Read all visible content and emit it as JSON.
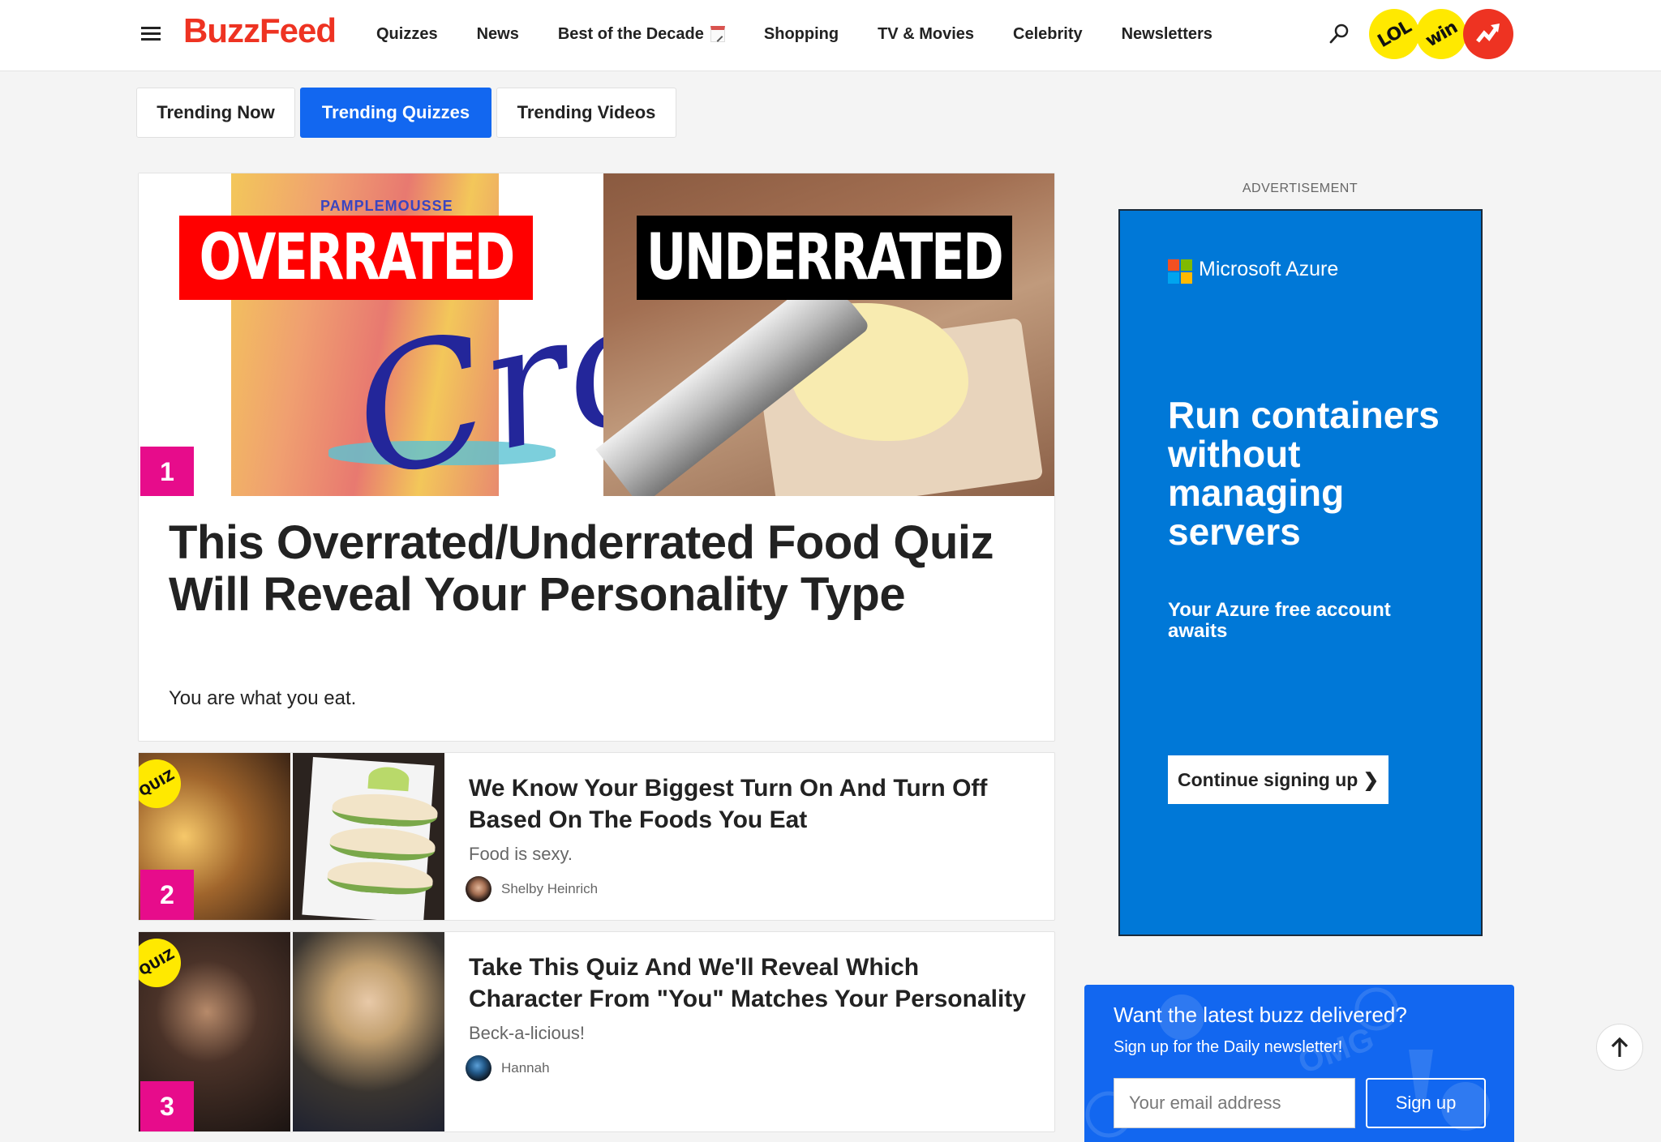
{
  "header": {
    "logo": "BuzzFeed",
    "brand_color": "#ee3322",
    "nav": [
      {
        "label": "Quizzes"
      },
      {
        "label": "News"
      },
      {
        "label": "Best of the Decade",
        "icon": "calendar-icon"
      },
      {
        "label": "Shopping"
      },
      {
        "label": "TV & Movies"
      },
      {
        "label": "Celebrity"
      },
      {
        "label": "Newsletters"
      }
    ],
    "badges": [
      {
        "label": "LOL",
        "color": "#ffe900"
      },
      {
        "label": "win",
        "color": "#ffe900"
      },
      {
        "label": "trending",
        "icon": "trending-arrow-icon",
        "color": "#ee3322"
      }
    ]
  },
  "tabs": [
    {
      "label": "Trending Now",
      "active": false
    },
    {
      "label": "Trending Quizzes",
      "active": true
    },
    {
      "label": "Trending Videos",
      "active": false
    }
  ],
  "accent_color": "#1267f0",
  "rank_color": "#e70c8b",
  "featured": {
    "rank": "1",
    "image_labels": {
      "left": "OVERRATED",
      "right": "UNDERRATED",
      "can_text": "PAMPLEMOUSSE",
      "can_script": "Croix"
    },
    "title": "This Overrated/Underrated Food Quiz Will Reveal Your Personality Type",
    "description": "You are what you eat."
  },
  "list": [
    {
      "rank": "2",
      "sticker": "QUIZ",
      "title": "We Know Your Biggest Turn On And Turn Off Based On The Foods You Eat",
      "description": "Food is sexy.",
      "author": "Shelby Heinrich"
    },
    {
      "rank": "3",
      "sticker": "QUIZ",
      "title": "Take This Quiz And We'll Reveal Which Character From \"You\" Matches Your Personality",
      "description": "Beck-a-licious!",
      "author": "Hannah"
    }
  ],
  "ad": {
    "label": "ADVERTISEMENT",
    "brand": "Microsoft Azure",
    "headline": "Run containers without managing servers",
    "subline": "Your Azure free account awaits",
    "cta": "Continue signing up ❯",
    "background": "#0078d7"
  },
  "newsletter": {
    "title": "Want the latest buzz delivered?",
    "subtitle": "Sign up for the Daily newsletter!",
    "email_placeholder": "Your email address",
    "email_value": "",
    "button": "Sign up"
  },
  "back_to_top": {
    "icon": "arrow-up-icon"
  }
}
